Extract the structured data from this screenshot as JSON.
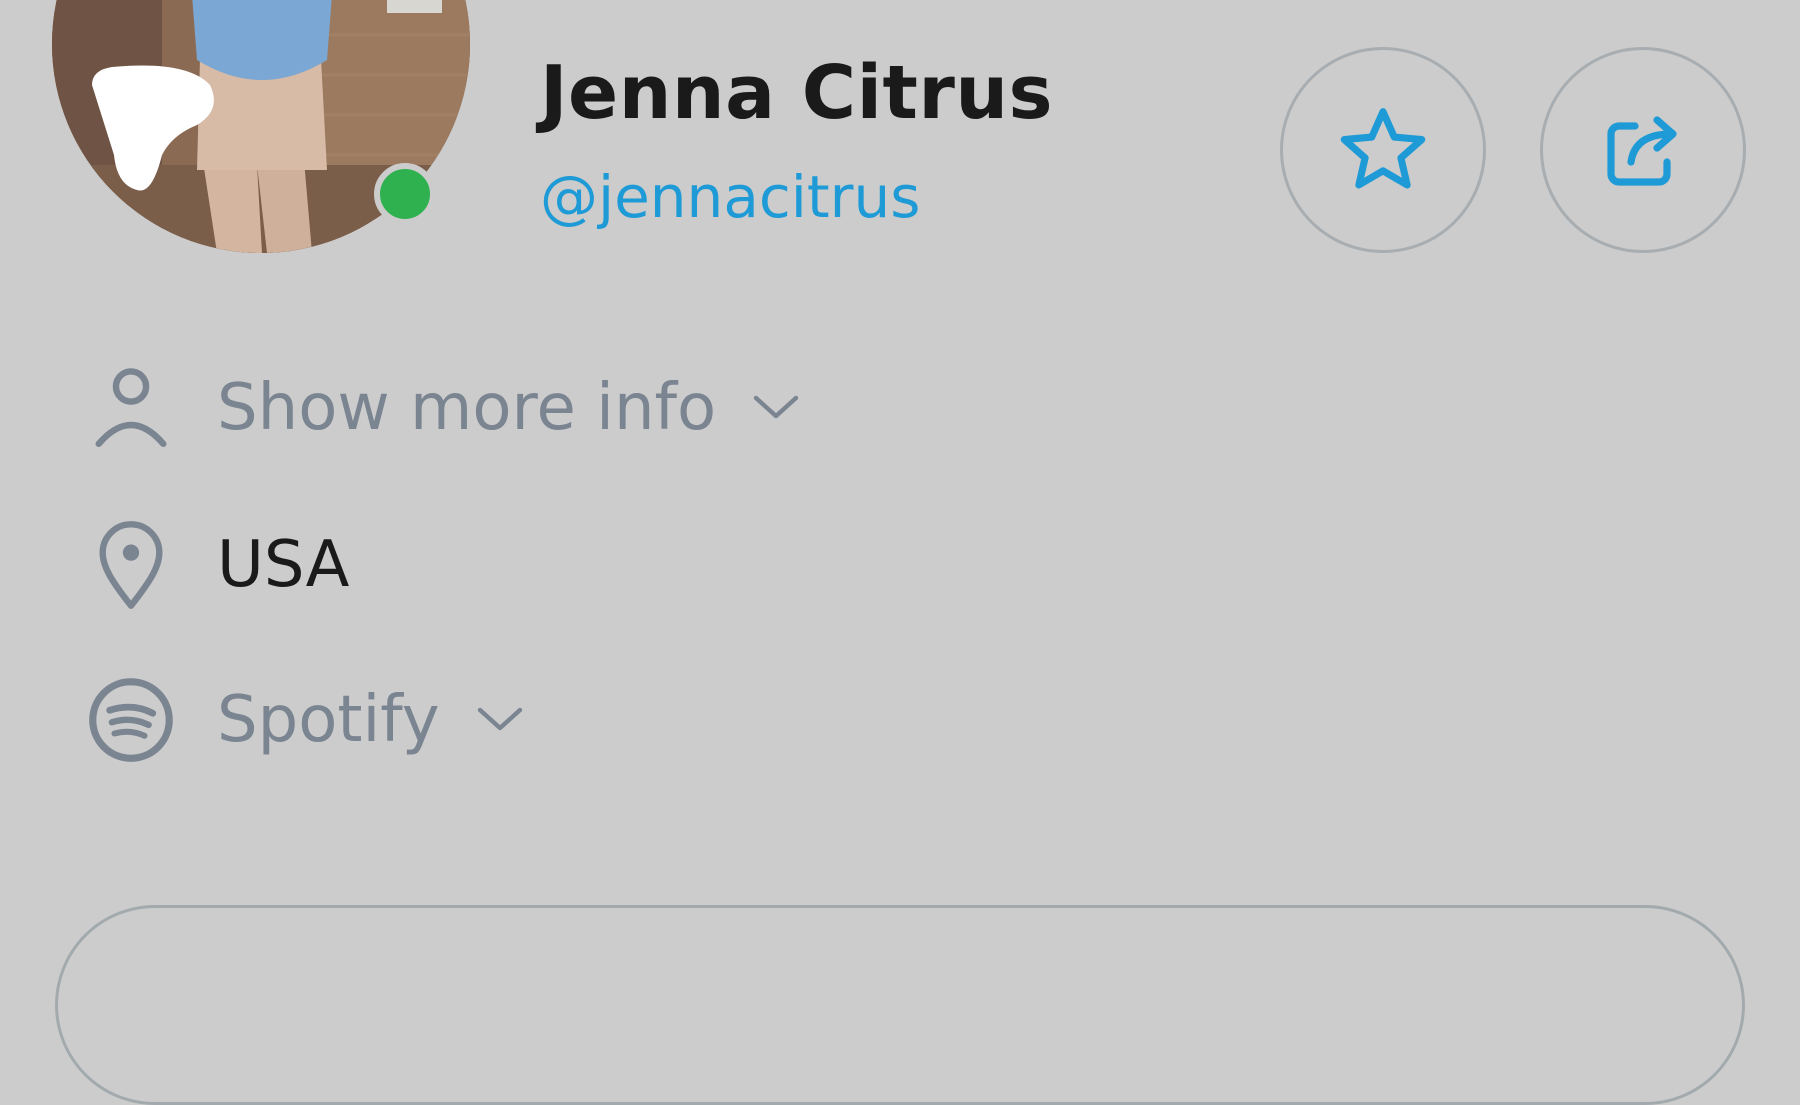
{
  "profile": {
    "display_name": "Jenna Citrus",
    "username": "@jennacitrus",
    "online": true
  },
  "actions": {
    "favorite_icon": "star-outline-icon",
    "share_icon": "share-icon"
  },
  "info": {
    "more_info_label": "Show more info",
    "location": "USA",
    "spotify_label": "Spotify"
  },
  "colors": {
    "accent": "#1e9bd6",
    "online": "#2fb14f",
    "muted": "#7a8591",
    "background": "#cccccc"
  }
}
